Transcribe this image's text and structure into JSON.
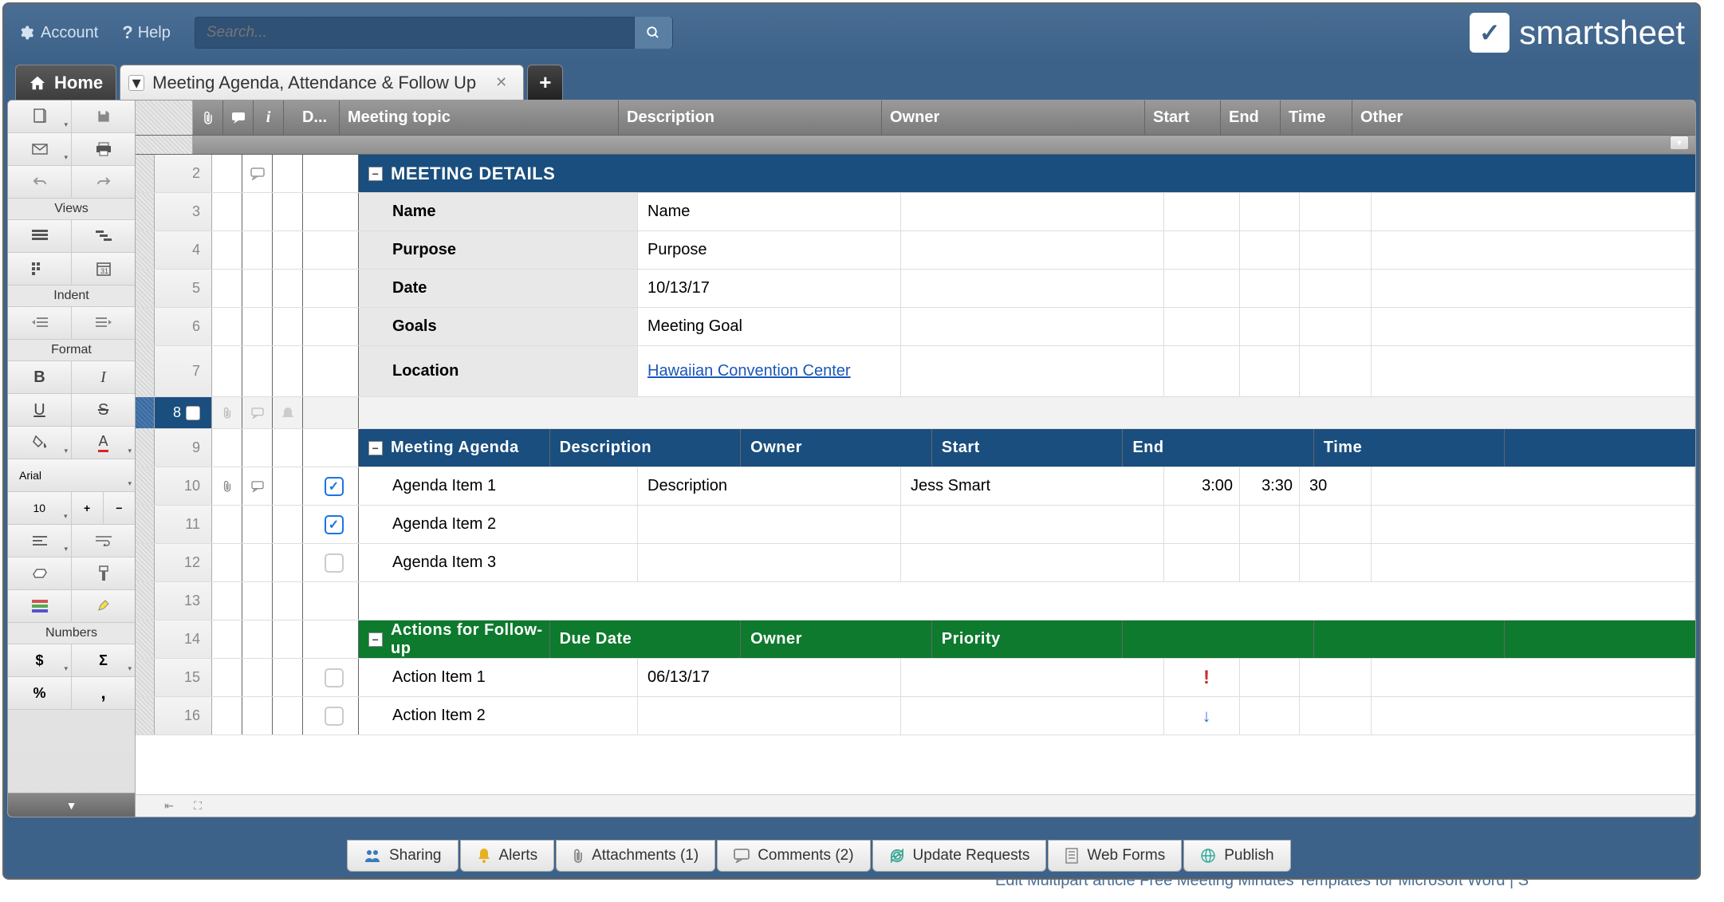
{
  "topbar": {
    "account": "Account",
    "help": "Help",
    "search_placeholder": "Search...",
    "brand": "smartsheet"
  },
  "tabs": {
    "home": "Home",
    "active": "Meeting Agenda, Attendance & Follow Up"
  },
  "columns": {
    "done": "D...",
    "topic": "Meeting topic",
    "desc": "Description",
    "owner": "Owner",
    "start": "Start",
    "end": "End",
    "time": "Time",
    "other": "Other"
  },
  "toolbox": {
    "views": "Views",
    "indent": "Indent",
    "format": "Format",
    "numbers": "Numbers",
    "font": "Arial",
    "size": "10"
  },
  "rows": {
    "r2_topic": "MEETING DETAILS",
    "r3_topic": "Name",
    "r3_desc": "Name",
    "r4_topic": "Purpose",
    "r4_desc": "Purpose",
    "r5_topic": "Date",
    "r5_desc": "10/13/17",
    "r6_topic": "Goals",
    "r6_desc": "Meeting Goal",
    "r7_topic": "Location",
    "r7_desc": "Hawaiian Convention Center",
    "r9_topic": "Meeting Agenda",
    "r9_desc": "Description",
    "r9_owner": "Owner",
    "r9_start": "Start",
    "r9_end": "End",
    "r9_time": "Time",
    "r10_topic": "Agenda Item 1",
    "r10_desc": "Description",
    "r10_owner": "Jess Smart",
    "r10_start": "3:00",
    "r10_end": "3:30",
    "r10_time": "30",
    "r11_topic": "Agenda Item 2",
    "r12_topic": "Agenda Item 3",
    "r14_topic": "Actions for Follow-up",
    "r14_desc": "Due Date",
    "r14_owner": "Owner",
    "r14_start": "Priority",
    "r15_topic": "Action Item 1",
    "r15_desc": "06/13/17",
    "r16_topic": "Action Item 2"
  },
  "footer": {
    "sharing": "Sharing",
    "alerts": "Alerts",
    "attachments": "Attachments (1)",
    "comments": "Comments (2)",
    "update": "Update Requests",
    "webforms": "Web Forms",
    "publish": "Publish",
    "bgtext": "Edit Multipart article Free Meeting Minutes Templates for Microsoft Word | S"
  }
}
